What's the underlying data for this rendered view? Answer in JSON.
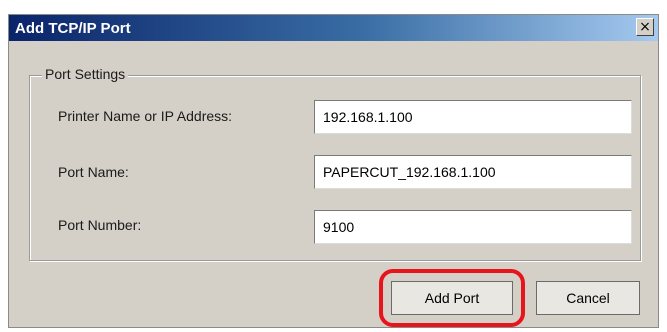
{
  "window": {
    "title": "Add TCP/IP Port",
    "close_glyph": "×"
  },
  "group": {
    "legend": "Port Settings"
  },
  "fields": [
    {
      "label": "Printer Name or IP Address:",
      "value": "192.168.1.100"
    },
    {
      "label": "Port Name:",
      "value": "PAPERCUT_192.168.1.100"
    },
    {
      "label": "Port Number:",
      "value": "9100"
    }
  ],
  "buttons": {
    "add_port": "Add Port",
    "cancel": "Cancel"
  },
  "colors": {
    "titlebar_start": "#0a246a",
    "titlebar_end": "#a6caf0",
    "dialog_background": "#d4d0c8",
    "highlight": "#e8141b"
  },
  "icons": {
    "close": "close-icon"
  }
}
